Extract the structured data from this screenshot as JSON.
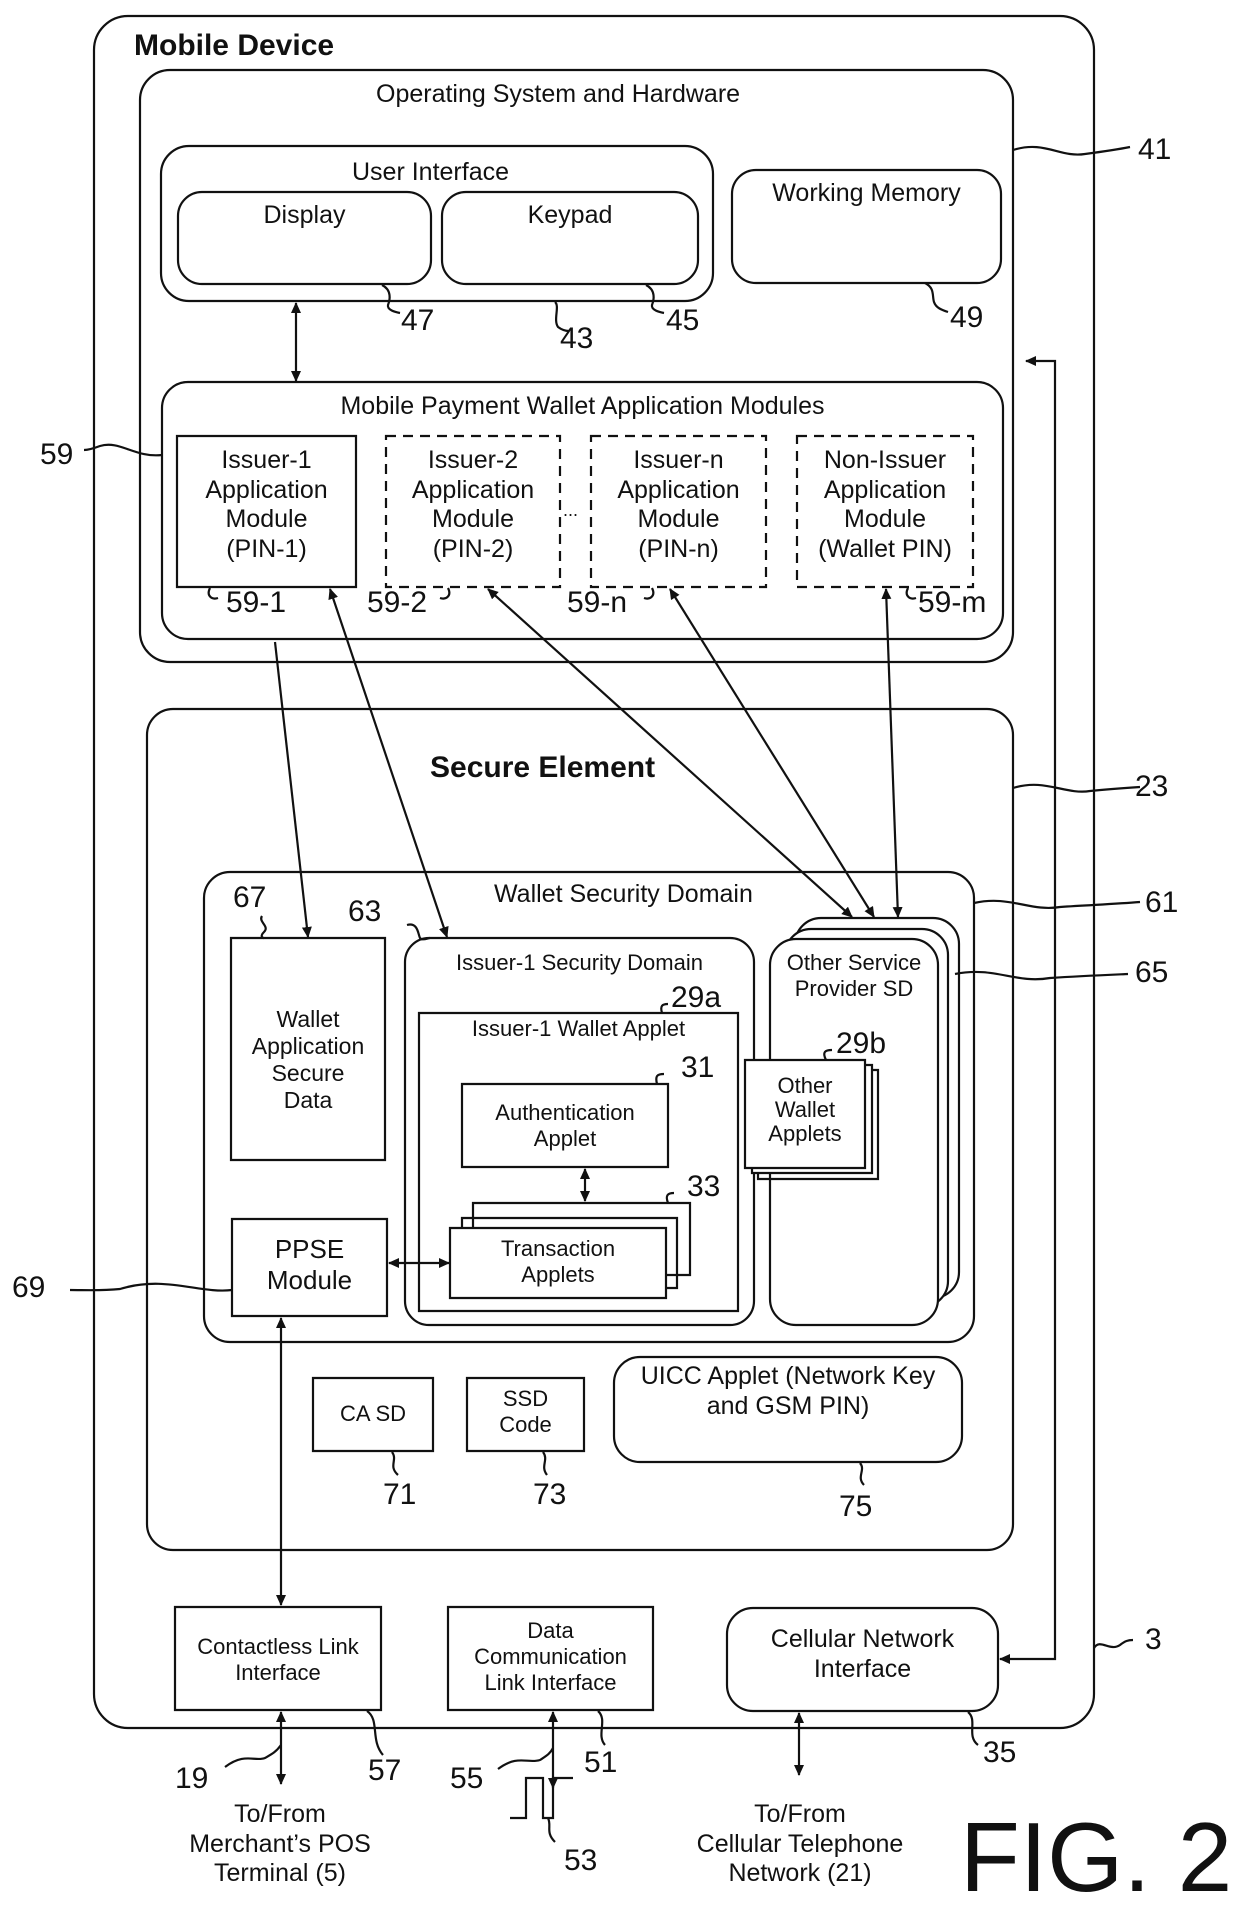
{
  "figure": {
    "label": "FIG. 2",
    "colors": {
      "ink": "#111111",
      "background": "#ffffff"
    }
  },
  "mobile_device": {
    "title": "Mobile Device",
    "ref": "3",
    "os_hardware": {
      "title": "Operating System and Hardware",
      "ref": "41",
      "user_interface": {
        "title": "User Interface",
        "ref": "43",
        "display": {
          "label": "Display",
          "ref": "47"
        },
        "keypad": {
          "label": "Keypad",
          "ref": "45"
        }
      },
      "working_memory": {
        "label": "Working Memory",
        "ref": "49"
      },
      "wallet_modules": {
        "title": "Mobile Payment Wallet Application Modules",
        "ref": "59",
        "ellipsis": "...",
        "modules": [
          {
            "lines": [
              "Issuer-1",
              "Application",
              "Module",
              "(PIN-1)"
            ],
            "ref": "59-1",
            "style": "solid"
          },
          {
            "lines": [
              "Issuer-2",
              "Application",
              "Module",
              "(PIN-2)"
            ],
            "ref": "59-2",
            "style": "dashed"
          },
          {
            "lines": [
              "Issuer-n",
              "Application",
              "Module",
              "(PIN-n)"
            ],
            "ref": "59-n",
            "style": "dashed"
          },
          {
            "lines": [
              "Non-Issuer",
              "Application",
              "Module",
              "(Wallet PIN)"
            ],
            "ref": "59-m",
            "style": "dashed"
          }
        ]
      }
    },
    "secure_element": {
      "title": "Secure Element",
      "ref": "23",
      "wallet_security_domain": {
        "title": "Wallet Security Domain",
        "ref": "61",
        "secure_data": {
          "lines": [
            "Wallet",
            "Application",
            "Secure",
            "Data"
          ],
          "ref": "67"
        },
        "ppse": {
          "lines": [
            "PPSE",
            "Module"
          ],
          "ref": "69"
        },
        "issuer1_sd": {
          "title": "Issuer-1 Security Domain",
          "ref": "63",
          "wallet_applet": {
            "title": "Issuer-1 Wallet Applet",
            "ref": "29a",
            "auth_applet": {
              "lines": [
                "Authentication",
                "Applet"
              ],
              "ref": "31"
            },
            "transaction_applets": {
              "lines": [
                "Transaction",
                "Applets"
              ],
              "ref": "33"
            }
          }
        },
        "other_sp_sd": {
          "lines": [
            "Other Service",
            "Provider SD"
          ],
          "ref": "65",
          "other_applets": {
            "lines": [
              "Other",
              "Wallet",
              "Applets"
            ],
            "ref": "29b"
          }
        }
      },
      "ca_sd": {
        "label": "CA SD",
        "ref": "71"
      },
      "ssd_code": {
        "lines": [
          "SSD",
          "Code"
        ],
        "ref": "73"
      },
      "uicc_applet": {
        "lines": [
          "UICC Applet (Network Key",
          "and GSM PIN)"
        ],
        "ref": "75"
      }
    },
    "interfaces": {
      "contactless": {
        "lines": [
          "Contactless Link",
          "Interface"
        ],
        "ref": "57",
        "link_ref": "19",
        "destination": [
          "To/From",
          "Merchant’s POS",
          "Terminal (5)"
        ]
      },
      "data_comm": {
        "lines": [
          "Data",
          "Communication",
          "Link Interface"
        ],
        "ref": "51",
        "link_ref": "55",
        "signal_ref": "53"
      },
      "cellular": {
        "lines": [
          "Cellular Network",
          "Interface"
        ],
        "ref": "35",
        "destination": [
          "To/From",
          "Cellular Telephone",
          "Network (21)"
        ]
      }
    }
  }
}
